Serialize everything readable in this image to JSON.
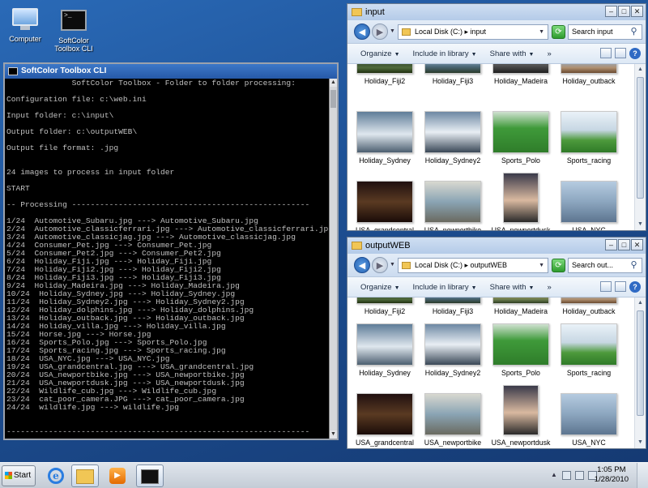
{
  "desktop": {
    "icons": [
      {
        "label": "Computer"
      },
      {
        "label": "SoftColor Toolbox CLI"
      }
    ]
  },
  "console": {
    "title": "SoftColor Toolbox CLI",
    "lines": [
      "              SoftColor Toolbox - Folder to folder processing:",
      "",
      "Configuration file: c:\\web.ini",
      "",
      "Input folder: c:\\input\\",
      "",
      "Output folder: c:\\outputWEB\\",
      "",
      "Output file format: .jpg",
      "",
      "",
      "24 images to process in input folder",
      "",
      "START",
      "",
      "-- Processing ---------------------------------------------------",
      "",
      "1/24  Automotive_Subaru.jpg ---> Automotive_Subaru.jpg",
      "2/24  Automotive_classicferrari.jpg ---> Automotive_classicferrari.jpg",
      "3/24  Automotive_classicjag.jpg ---> Automotive_classicjag.jpg",
      "4/24  Consumer_Pet.jpg ---> Consumer_Pet.jpg",
      "5/24  Consumer_Pet2.jpg ---> Consumer_Pet2.jpg",
      "6/24  Holiday_Fiji.jpg ---> Holiday_Fiji.jpg",
      "7/24  Holiday_Fiji2.jpg ---> Holiday_Fiji2.jpg",
      "8/24  Holiday_Fiji3.jpg ---> Holiday_Fiji3.jpg",
      "9/24  Holiday_Madeira.jpg ---> Holiday_Madeira.jpg",
      "10/24  Holiday_Sydney.jpg ---> Holiday_Sydney.jpg",
      "11/24  Holiday_Sydney2.jpg ---> Holiday_Sydney2.jpg",
      "12/24  Holiday_dolphins.jpg ---> Holiday_dolphins.jpg",
      "13/24  Holiday_outback.jpg ---> Holiday_outback.jpg",
      "14/24  Holiday_villa.jpg ---> Holiday_villa.jpg",
      "15/24  Horse.jpg ---> Horse.jpg",
      "16/24  Sports_Polo.jpg ---> Sports_Polo.jpg",
      "17/24  Sports_racing.jpg ---> Sports_racing.jpg",
      "18/24  USA_NYC.jpg ---> USA_NYC.jpg",
      "19/24  USA_grandcentral.jpg ---> USA_grandcentral.jpg",
      "20/24  USA_newportbike.jpg ---> USA_newportbike.jpg",
      "21/24  USA_newportdusk.jpg ---> USA_newportdusk.jpg",
      "22/24  Wildlife_cub.jpg ---> Wildlife_cub.jpg",
      "23/24  cat_poor_camera.JPG ---> cat_poor_camera.jpg",
      "24/24  wildlife.jpg ---> wildlife.jpg",
      "",
      "",
      "-----------------------------------------------------------------",
      "",
      "READY",
      "",
      "C:\\>"
    ]
  },
  "input_window": {
    "title": "input",
    "path": "Local Disk (C:)  ▸  input",
    "search_placeholder": "Search input",
    "toolbar": [
      "Organize",
      "Include in library",
      "Share with",
      "»"
    ],
    "items": [
      {
        "label": "Holiday_Fiji2",
        "photo": "fiji1"
      },
      {
        "label": "Holiday_Fiji3",
        "photo": "fiji2"
      },
      {
        "label": "Holiday_Madeira",
        "photo": "madeira"
      },
      {
        "label": "Holiday_outback",
        "photo": "outback"
      },
      {
        "label": "Holiday_Sydney",
        "photo": "sydney"
      },
      {
        "label": "Holiday_Sydney2",
        "photo": "sydney2"
      },
      {
        "label": "Sports_Polo",
        "photo": "polo"
      },
      {
        "label": "Sports_racing",
        "photo": "racing"
      },
      {
        "label": "USA_grandcentral",
        "photo": "grand"
      },
      {
        "label": "USA_newportbike",
        "photo": "bike"
      },
      {
        "label": "USA_newportdusk",
        "photo": "dusk"
      },
      {
        "label": "USA_NYC",
        "photo": "nyc"
      }
    ]
  },
  "output_window": {
    "title": "outputWEB",
    "path": "Local Disk (C:)  ▸  outputWEB",
    "search_placeholder": "Search out...",
    "toolbar": [
      "Organize",
      "Include in library",
      "Share with",
      "»"
    ],
    "items": [
      {
        "label": "Holiday_Fiji2",
        "photo": "fiji1"
      },
      {
        "label": "Holiday_Fiji3",
        "photo": "fiji2"
      },
      {
        "label": "Holiday_Madeira",
        "photo": "fiji3"
      },
      {
        "label": "Holiday_outback",
        "photo": "outback"
      },
      {
        "label": "Holiday_Sydney",
        "photo": "sydney"
      },
      {
        "label": "Holiday_Sydney2",
        "photo": "sydney2"
      },
      {
        "label": "Sports_Polo",
        "photo": "polo"
      },
      {
        "label": "Sports_racing",
        "photo": "racing"
      },
      {
        "label": "USA_grandcentral",
        "photo": "grand"
      },
      {
        "label": "USA_newportbike",
        "photo": "bike"
      },
      {
        "label": "USA_newportdusk",
        "photo": "dusk"
      },
      {
        "label": "USA_NYC",
        "photo": "nyc"
      }
    ]
  },
  "taskbar": {
    "start_label": "Start",
    "time": "1:05 PM",
    "date": "1/28/2010"
  }
}
